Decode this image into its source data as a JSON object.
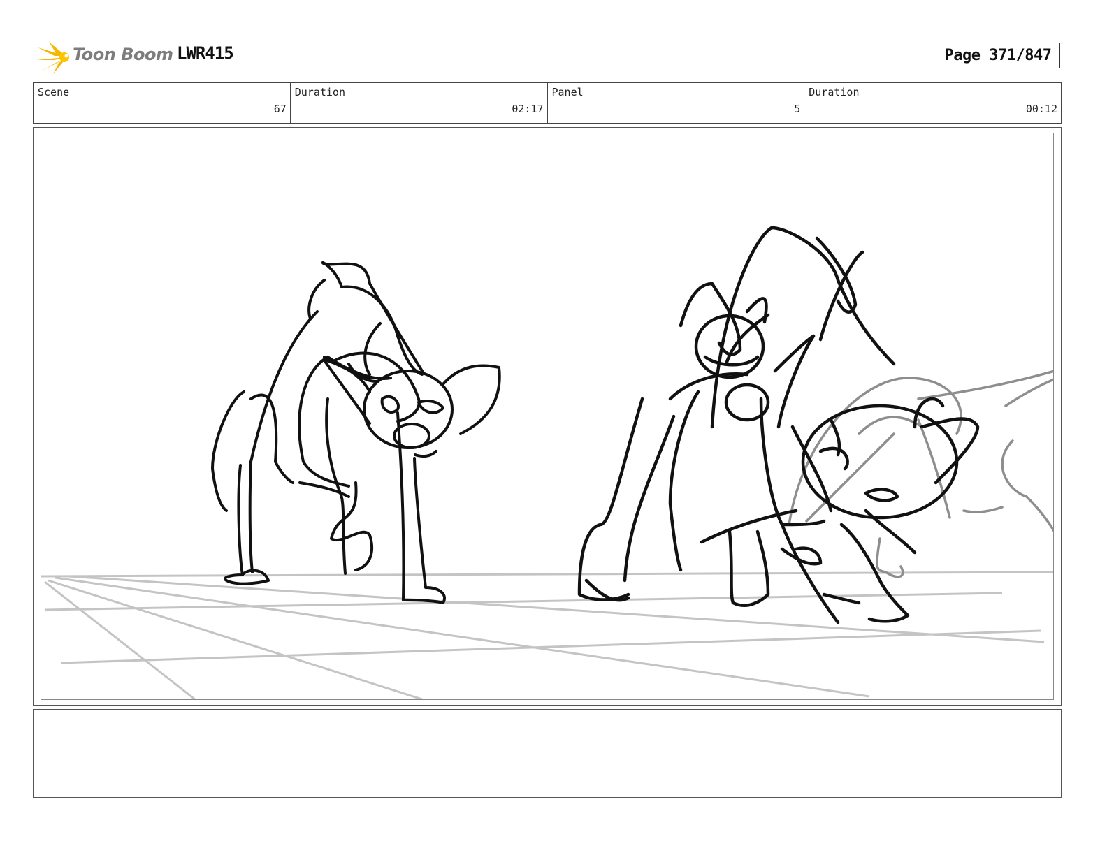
{
  "header": {
    "brand": "Toon Boom",
    "project_code": "LWR415",
    "page_label": "Page 371/847"
  },
  "info": {
    "scene_label": "Scene",
    "scene_value": "67",
    "scene_duration_label": "Duration",
    "scene_duration_value": "02:17",
    "panel_label": "Panel",
    "panel_value": "5",
    "panel_duration_label": "Duration",
    "panel_duration_value": "00:12"
  },
  "panel_image": {
    "icon": "storyboard-sketch-image",
    "line_color": "#111111",
    "guide_color": "#bdbdbd"
  },
  "notes": {
    "text": ""
  },
  "colors": {
    "logo_accent": "#f5b800",
    "logo_text": "#7d7d7d",
    "border": "#444444"
  }
}
